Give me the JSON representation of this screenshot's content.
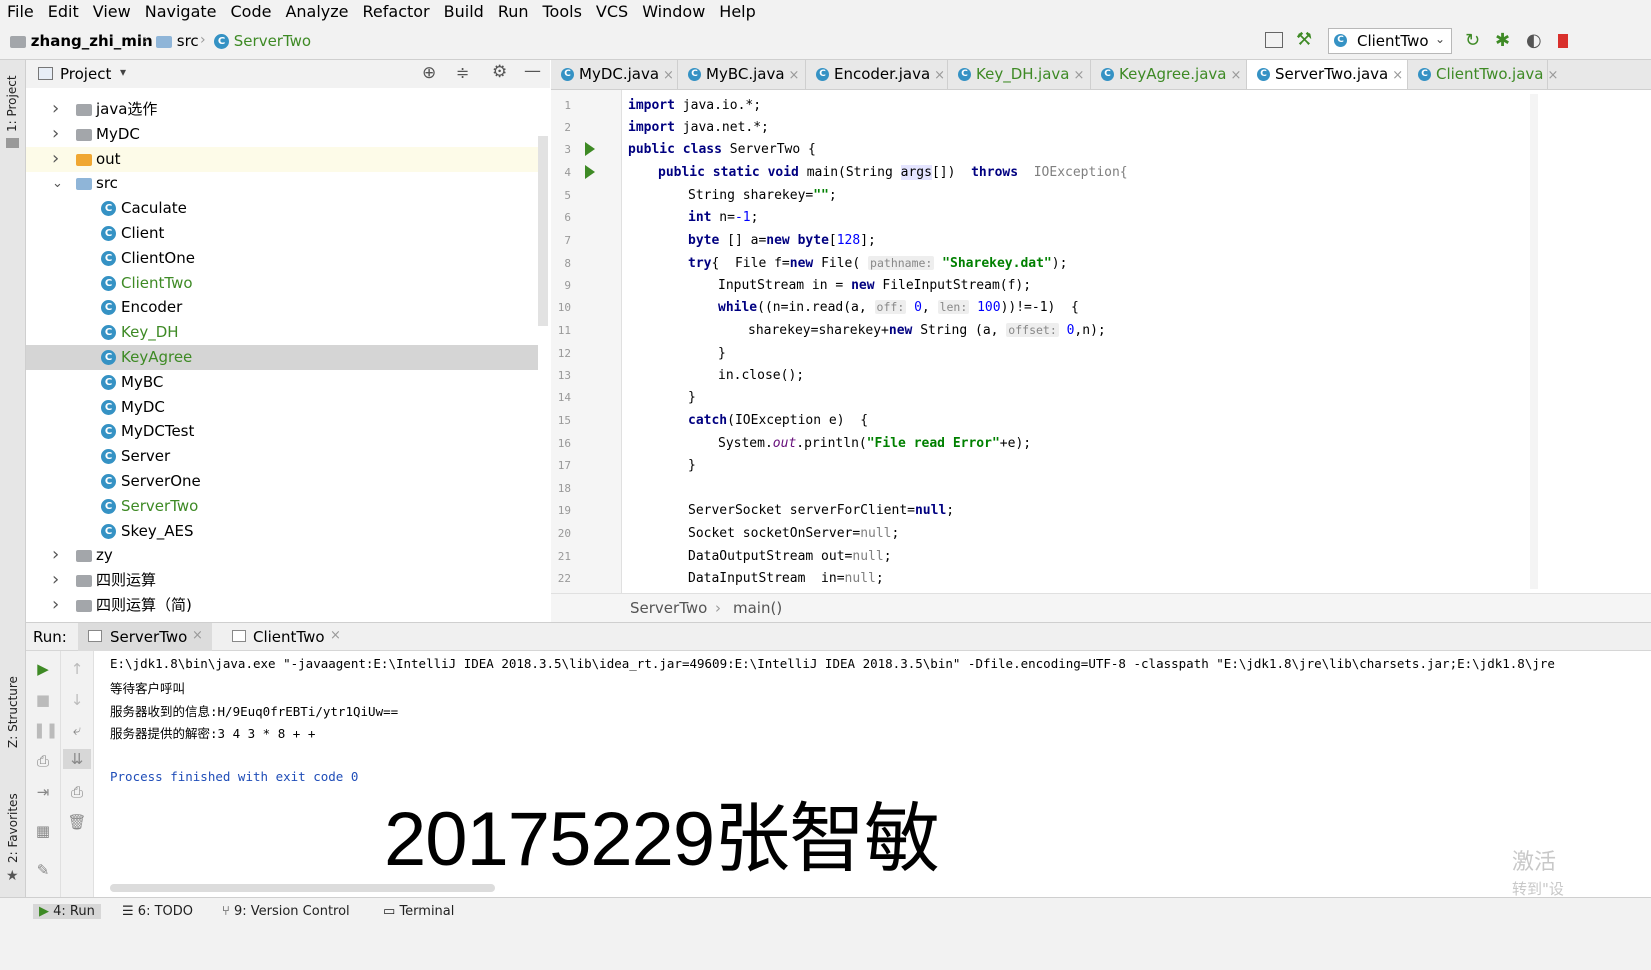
{
  "menu": [
    "File",
    "Edit",
    "View",
    "Navigate",
    "Code",
    "Analyze",
    "Refactor",
    "Build",
    "Run",
    "Tools",
    "VCS",
    "Window",
    "Help"
  ],
  "nav": {
    "project": "zhang_zhi_min",
    "folder": "src",
    "file": "ServerTwo",
    "run_config": "ClientTwo"
  },
  "left_strip": {
    "project": "1: Project",
    "structure": "Z: Structure",
    "favorites": "2: Favorites"
  },
  "project_panel": {
    "title": "Project"
  },
  "tree": [
    {
      "label": "java选作",
      "type": "folder",
      "arrow": "›",
      "depth": 0
    },
    {
      "label": "MyDC",
      "type": "folder",
      "arrow": "›",
      "depth": 0
    },
    {
      "label": "out",
      "type": "folder-orange",
      "arrow": "›",
      "depth": 0
    },
    {
      "label": "src",
      "type": "folder-blue",
      "arrow": "⌄",
      "depth": 0
    },
    {
      "label": "Caculate",
      "type": "class",
      "depth": 1
    },
    {
      "label": "Client",
      "type": "class",
      "depth": 1
    },
    {
      "label": "ClientOne",
      "type": "class",
      "depth": 1
    },
    {
      "label": "ClientTwo",
      "type": "class-green",
      "depth": 1
    },
    {
      "label": "Encoder",
      "type": "class",
      "depth": 1
    },
    {
      "label": "Key_DH",
      "type": "class-green",
      "depth": 1
    },
    {
      "label": "KeyAgree",
      "type": "class-green",
      "depth": 1,
      "selected": true
    },
    {
      "label": "MyBC",
      "type": "class",
      "depth": 1
    },
    {
      "label": "MyDC",
      "type": "class",
      "depth": 1
    },
    {
      "label": "MyDCTest",
      "type": "class",
      "depth": 1
    },
    {
      "label": "Server",
      "type": "class",
      "depth": 1
    },
    {
      "label": "ServerOne",
      "type": "class",
      "depth": 1
    },
    {
      "label": "ServerTwo",
      "type": "class-green",
      "depth": 1
    },
    {
      "label": "Skey_AES",
      "type": "class",
      "depth": 1
    },
    {
      "label": "zy",
      "type": "folder",
      "arrow": "›",
      "depth": 0
    },
    {
      "label": "四则运算",
      "type": "folder",
      "arrow": "›",
      "depth": 0
    },
    {
      "label": "四则运算（简)",
      "type": "folder",
      "arrow": "›",
      "depth": 0
    }
  ],
  "tabs": [
    {
      "label": "MyDC.java",
      "green": false,
      "active": false
    },
    {
      "label": "MyBC.java",
      "green": false,
      "active": false
    },
    {
      "label": "Encoder.java",
      "green": false,
      "active": false
    },
    {
      "label": "Key_DH.java",
      "green": true,
      "active": false
    },
    {
      "label": "KeyAgree.java",
      "green": true,
      "active": false
    },
    {
      "label": "ServerTwo.java",
      "green": false,
      "active": true
    },
    {
      "label": "ClientTwo.java",
      "green": true,
      "active": false
    }
  ],
  "code": {
    "line_numbers": [
      "1",
      "2",
      "3",
      "4",
      "5",
      "6",
      "7",
      "8",
      "9",
      "10",
      "11",
      "12",
      "13",
      "14",
      "15",
      "16",
      "17",
      "18",
      "19",
      "20",
      "21",
      "22"
    ],
    "l1a": "import",
    "l1b": " java.io.*;",
    "l2a": "import",
    "l2b": " java.net.*;",
    "l3a": "public class",
    "l3b": " ServerTwo {",
    "l4a": "public static void",
    "l4b": " main(String ",
    "l4c": "args",
    "l4d": "[])  ",
    "l4e": "throws",
    "l4f": "  IOException{",
    "l5a": "String sharekey=",
    "l5b": "\"\"",
    "l5c": ";",
    "l6a": "int",
    "l6b": " n=",
    "l6c": "-1",
    "l6d": ";",
    "l7a": "byte",
    "l7b": " [] a=",
    "l7c": "new byte",
    "l7d": "[",
    "l7e": "128",
    "l7f": "];",
    "l8a": "try",
    "l8b": "{  File f=",
    "l8c": "new",
    "l8d": " File( ",
    "l8e": "pathname:",
    "l8f": " \"Sharekey.dat\"",
    "l8g": ");",
    "l9a": "InputStream in = ",
    "l9b": "new",
    "l9c": " FileInputStream(f);",
    "l10a": "while",
    "l10b": "((n=in.read(a, ",
    "l10c": "off:",
    "l10d": " 0",
    "l10e": ", ",
    "l10f": "len:",
    "l10g": " 100",
    "l10h": "))!=-1)  {",
    "l11a": "sharekey=sharekey+",
    "l11b": "new",
    "l11c": " String (a, ",
    "l11d": "offset:",
    "l11e": " 0",
    "l11f": ",n);",
    "l12": "}",
    "l13": "in.close();",
    "l14": "}",
    "l15a": "catch",
    "l15b": "(IOException e)  {",
    "l16a": "System.",
    "l16b": "out",
    "l16c": ".println(",
    "l16d": "\"File read Error\"",
    "l16e": "+e);",
    "l17": "}",
    "l19a": "ServerSocket serverForClient=",
    "l19b": "null",
    "l19c": ";",
    "l20a": "Socket socketOnServer=",
    "l20b": "null",
    "l20c": ";",
    "l21a": "DataOutputStream out=",
    "l21b": "null",
    "l21c": ";",
    "l22a": "DataInputStream  in=",
    "l22b": "null",
    "l22c": ";"
  },
  "editor_breadcrumb": {
    "cls": "ServerTwo",
    "method": "main()"
  },
  "run": {
    "label": "Run:",
    "tabs": [
      "ServerTwo",
      "ClientTwo"
    ],
    "console": [
      "E:\\jdk1.8\\bin\\java.exe \"-javaagent:E:\\IntelliJ IDEA 2018.3.5\\lib\\idea_rt.jar=49609:E:\\IntelliJ IDEA 2018.3.5\\bin\" -Dfile.encoding=UTF-8 -classpath \"E:\\jdk1.8\\jre\\lib\\charsets.jar;E:\\jdk1.8\\jre",
      "等待客户呼叫",
      "服务器收到的信息:H/9Euq0frEBTi/ytr1QiUw==",
      "服务器提供的解密:3 4 3 * 8 + +",
      "",
      "Process finished with exit code 0"
    ],
    "overlay_text": "20175229张智敏",
    "watermark_1": "激活",
    "watermark_2": "转到\"设"
  },
  "status": {
    "run": "4: Run",
    "todo": "6: TODO",
    "vcs": "9: Version Control",
    "terminal": "Terminal"
  },
  "colors": {
    "accent_blue": "#3592c4",
    "vcs_green": "#3e8a25",
    "keyword": "#000080",
    "string": "#008000"
  }
}
